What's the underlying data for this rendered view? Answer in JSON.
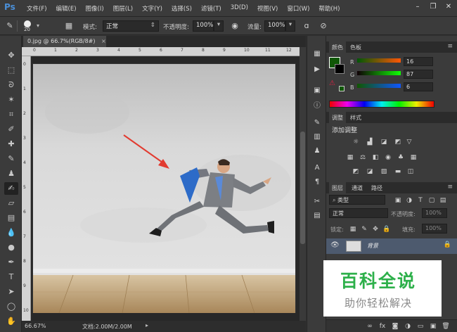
{
  "app": {
    "logo": "Ps"
  },
  "menu": [
    "文件(F)",
    "编辑(E)",
    "图像(I)",
    "图层(L)",
    "文字(Y)",
    "选择(S)",
    "滤镜(T)",
    "3D(D)",
    "视图(V)",
    "窗口(W)",
    "帮助(H)"
  ],
  "options": {
    "brush_size": "20",
    "mode_label": "模式:",
    "mode_value": "正常",
    "opacity_label": "不透明度:",
    "opacity_value": "100%",
    "flow_label": "流量:",
    "flow_value": "100%"
  },
  "document": {
    "tab_title": "0.jpg @ 66.7%(RGB/8#)",
    "zoom": "66.67%",
    "doc_size": "文档:2.00M/2.00M",
    "ruler_top": [
      "0",
      "1",
      "2",
      "3",
      "4",
      "5",
      "6",
      "7",
      "8",
      "9",
      "10",
      "11",
      "12"
    ],
    "ruler_left": [
      "0",
      "1",
      "2",
      "3",
      "4",
      "5",
      "6",
      "7",
      "8",
      "9",
      "10"
    ]
  },
  "color_panel": {
    "tabs": [
      "颜色",
      "色板"
    ],
    "r_label": "R",
    "r_value": "16",
    "g_label": "G",
    "g_value": "87",
    "b_label": "B",
    "b_value": "6",
    "foreground": "#105706"
  },
  "adjust_panel": {
    "tabs": [
      "调整",
      "样式"
    ],
    "title": "添加调整"
  },
  "layers_panel": {
    "tabs": [
      "图层",
      "通道",
      "路径"
    ],
    "filter_label": "类型",
    "blend_mode": "正常",
    "opacity_label": "不透明度:",
    "opacity_value": "100%",
    "lock_label": "锁定:",
    "fill_label": "填充:",
    "fill_value": "100%",
    "layer_name": "背景"
  },
  "watermark": {
    "title": "百科全说",
    "subtitle": "助你轻松解决"
  }
}
